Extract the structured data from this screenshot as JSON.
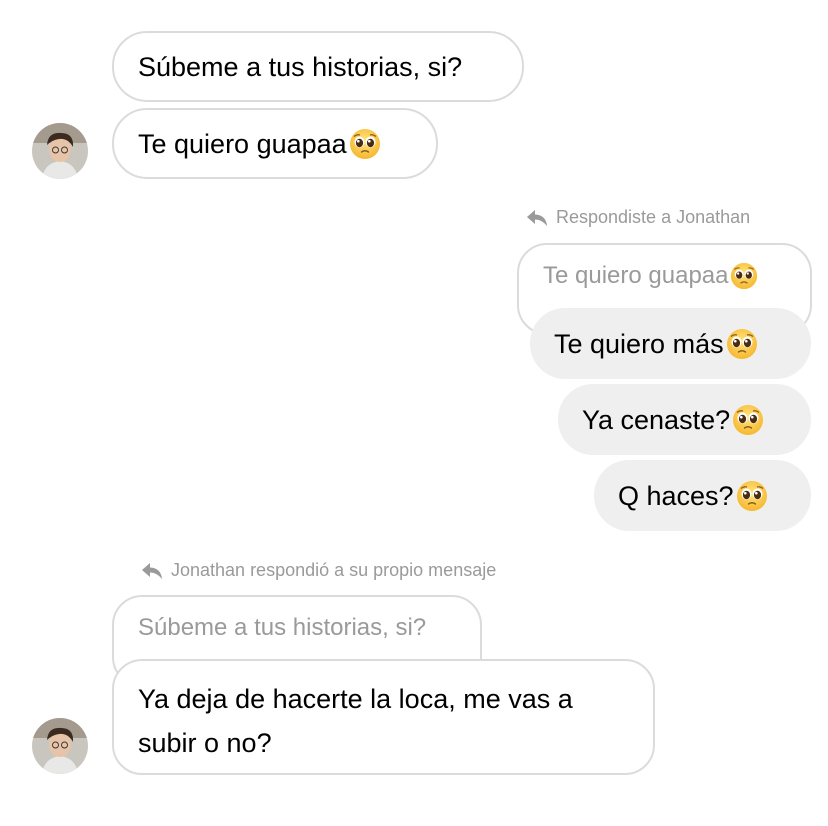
{
  "messages": {
    "m1": "Súbeme a tus historias, si?",
    "m2": "Te quiero guapaa",
    "reply1_note": "Respondiste a Jonathan",
    "reply1_quote": "Te quiero guapaa",
    "m3": "Te quiero más",
    "m4": "Ya cenaste?",
    "m5": "Q haces?",
    "reply2_note": "Jonathan respondió a su propio mensaje",
    "reply2_quote": "Súbeme a tus historias, si?",
    "m6_line1": "Ya deja de hacerte la loca, me vas a",
    "m6_line2": "subir o no?"
  },
  "icons": {
    "emoji": "pleading-face-emoji",
    "reply": "reply-arrow-icon",
    "avatar": "contact-avatar"
  },
  "colors": {
    "incoming_border": "#dbdbdb",
    "outgoing_bg": "#efefef",
    "meta_text": "#9a9a9a"
  }
}
